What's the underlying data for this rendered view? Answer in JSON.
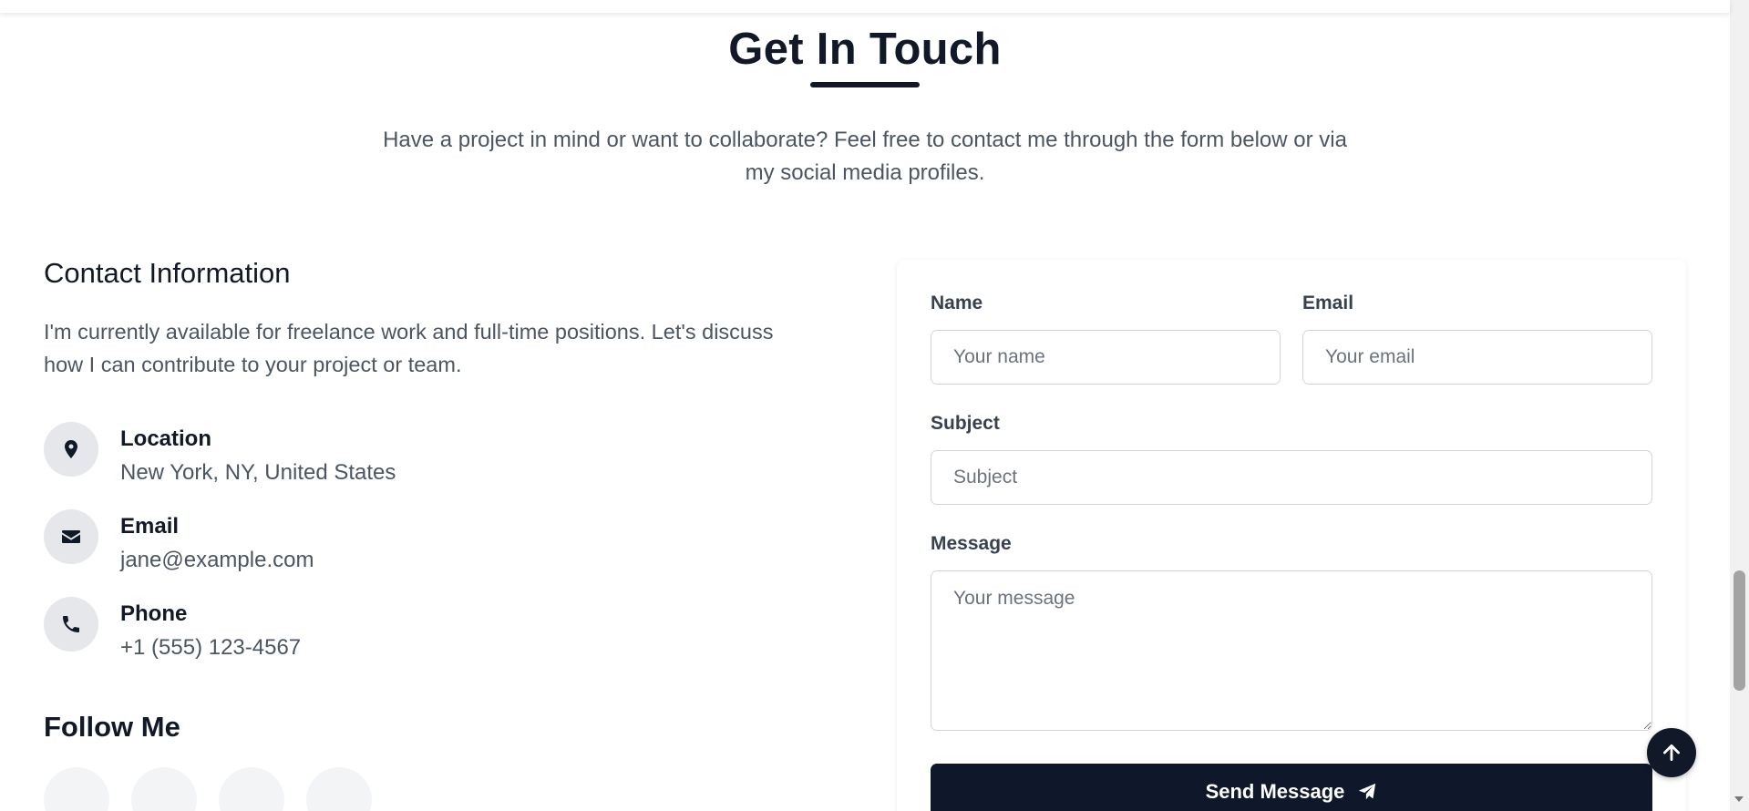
{
  "section": {
    "title": "Get In Touch",
    "intro": "Have a project in mind or want to collaborate? Feel free to contact me through the form below or via my social media profiles."
  },
  "contact_info": {
    "heading": "Contact Information",
    "text": "I'm currently available for freelance work and full-time positions. Let's discuss how I can contribute to your project or team.",
    "items": [
      {
        "icon": "location-pin-icon",
        "label": "Location",
        "value": "New York, NY, United States"
      },
      {
        "icon": "envelope-icon",
        "label": "Email",
        "value": "jane@example.com"
      },
      {
        "icon": "phone-icon",
        "label": "Phone",
        "value": "+1 (555) 123-4567"
      }
    ]
  },
  "social": {
    "heading": "Follow Me"
  },
  "form": {
    "name_label": "Name",
    "name_placeholder": "Your name",
    "email_label": "Email",
    "email_placeholder": "Your email",
    "subject_label": "Subject",
    "subject_placeholder": "Subject",
    "message_label": "Message",
    "message_placeholder": "Your message",
    "submit_label": "Send Message",
    "submit_icon": "paper-plane-icon"
  },
  "scroll_top_icon": "arrow-up-icon",
  "colors": {
    "primary": "#0f172a",
    "text": "#111827",
    "muted": "#4b5563",
    "icon_bg": "#e5e7eb"
  }
}
